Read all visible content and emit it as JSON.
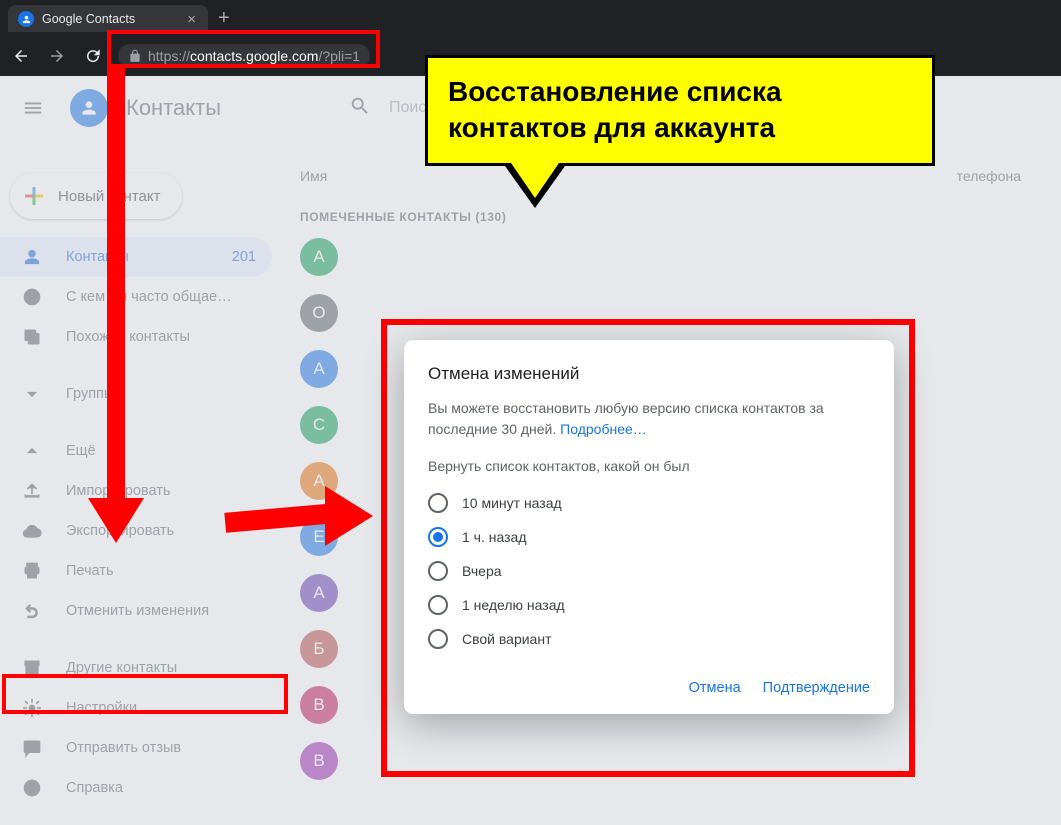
{
  "browser": {
    "tab_title": "Google Contacts",
    "url_scheme": "https://",
    "url_host": "contacts.google.com",
    "url_path": "/?pli=1"
  },
  "callout": {
    "text": "Восстановление списка контактов для аккаунта"
  },
  "header": {
    "product_name": "Контакты",
    "search_placeholder": "Поиск"
  },
  "sidebar": {
    "create_label": "Новый контакт",
    "items": {
      "contacts": {
        "label": "Контакты",
        "count": "201"
      },
      "frequent": {
        "label": "С кем вы часто общае…"
      },
      "merge": {
        "label": "Похожие контакты"
      },
      "groups": {
        "label": "Группы"
      },
      "more": {
        "label": "Ещё"
      },
      "import": {
        "label": "Импортировать"
      },
      "export": {
        "label": "Экспортировать"
      },
      "print": {
        "label": "Печать"
      },
      "undo": {
        "label": "Отменить изменения"
      },
      "other": {
        "label": "Другие контакты"
      },
      "settings": {
        "label": "Настройки"
      },
      "feedback": {
        "label": "Отправить отзыв"
      },
      "help": {
        "label": "Справка"
      }
    }
  },
  "main": {
    "col_name": "Имя",
    "col_phone": "телефона",
    "section_label": "ПОМЕЧЕННЫЕ КОНТАКТЫ (130)",
    "avatars": [
      {
        "letter": "A",
        "color": "#0f9d58"
      },
      {
        "letter": "O",
        "color": "#5f6368"
      },
      {
        "letter": "A",
        "color": "#1a73e8"
      },
      {
        "letter": "C",
        "color": "#0f9d58"
      },
      {
        "letter": "A",
        "color": "#e8710a"
      },
      {
        "letter": "E",
        "color": "#1a73e8"
      },
      {
        "letter": "A",
        "color": "#673ab7"
      },
      {
        "letter": "Б",
        "color": "#ba4a4a"
      },
      {
        "letter": "B",
        "color": "#c2185b"
      },
      {
        "letter": "B",
        "color": "#9c27b0"
      }
    ]
  },
  "dialog": {
    "title": "Отмена изменений",
    "desc1": "Вы можете восстановить любую версию списка контактов за последние 30 дней. ",
    "desc_link": "Подробнее…",
    "prompt": "Вернуть список контактов, какой он был",
    "options": {
      "o1": "10 минут назад",
      "o2": "1 ч. назад",
      "o3": "Вчера",
      "o4": "1 неделю назад",
      "o5": "Свой вариант"
    },
    "cancel": "Отмена",
    "confirm": "Подтверждение"
  }
}
